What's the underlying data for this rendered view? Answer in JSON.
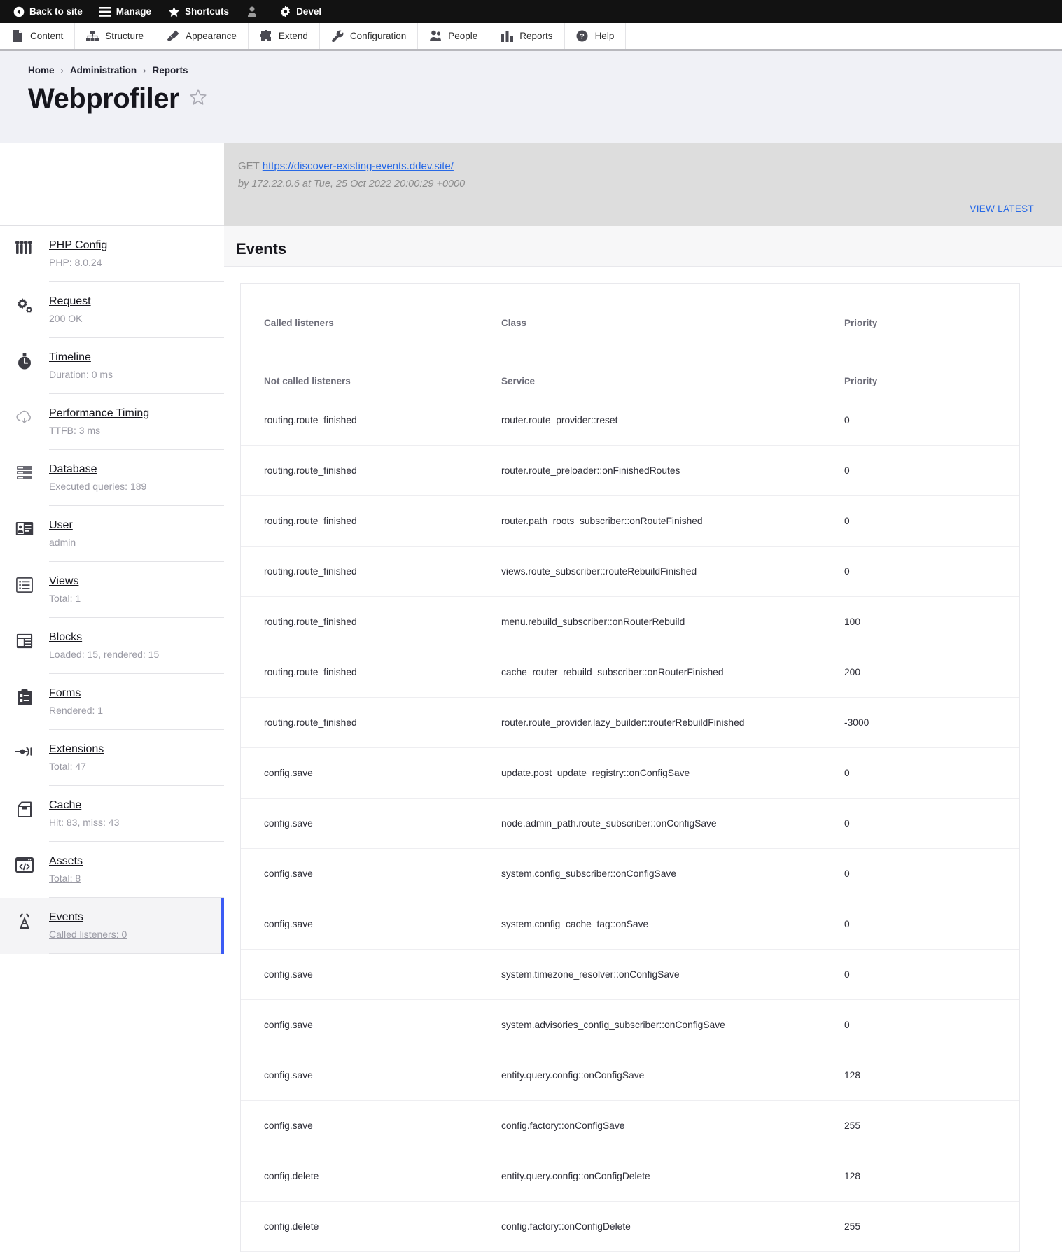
{
  "admin_bar": {
    "items": [
      {
        "label": "Back to site",
        "icon": "back-arrow-circle-icon"
      },
      {
        "label": "Manage",
        "icon": "hamburger-icon"
      },
      {
        "label": "Shortcuts",
        "icon": "star-icon"
      },
      {
        "label": "",
        "icon": "user-person-icon"
      },
      {
        "label": "Devel",
        "icon": "gear-icon"
      }
    ]
  },
  "menu_bar": {
    "items": [
      {
        "label": "Content",
        "icon": "page-icon"
      },
      {
        "label": "Structure",
        "icon": "sitemap-icon"
      },
      {
        "label": "Appearance",
        "icon": "paintbrush-icon"
      },
      {
        "label": "Extend",
        "icon": "puzzle-icon"
      },
      {
        "label": "Configuration",
        "icon": "wrench-icon"
      },
      {
        "label": "People",
        "icon": "people-icon"
      },
      {
        "label": "Reports",
        "icon": "bar-chart-icon"
      },
      {
        "label": "Help",
        "icon": "question-circle-icon"
      }
    ]
  },
  "breadcrumb": {
    "items": [
      "Home",
      "Administration",
      "Reports"
    ],
    "separator": "›"
  },
  "page": {
    "title": "Webprofiler",
    "star_label": "☆"
  },
  "request_banner": {
    "method": "GET",
    "url": "https://discover-existing-events.ddev.site/",
    "meta": "by 172.22.0.6 at Tue, 25 Oct 2022 20:00:29 +0000",
    "view_latest": "VIEW LATEST"
  },
  "sidebar": {
    "items": [
      {
        "title": "PHP Config",
        "sub": "PHP: 8.0.24",
        "icon": "sliders-icon",
        "active": false
      },
      {
        "title": "Request",
        "sub": "200 OK",
        "icon": "gears-icon",
        "active": false
      },
      {
        "title": "Timeline",
        "sub": "Duration: 0 ms",
        "icon": "stopwatch-icon",
        "active": false
      },
      {
        "title": "Performance Timing",
        "sub": "TTFB: 3 ms",
        "icon": "cloud-download-icon",
        "active": false
      },
      {
        "title": "Database",
        "sub": "Executed queries: 189",
        "icon": "database-icon",
        "active": false
      },
      {
        "title": "User",
        "sub": "admin",
        "icon": "id-card-icon",
        "active": false
      },
      {
        "title": "Views",
        "sub": "Total: 1",
        "icon": "list-icon",
        "active": false
      },
      {
        "title": "Blocks",
        "sub": "Loaded: 15, rendered: 15",
        "icon": "layout-blocks-icon",
        "active": false
      },
      {
        "title": "Forms",
        "sub": "Rendered: 1",
        "icon": "clipboard-form-icon",
        "active": false
      },
      {
        "title": "Extensions",
        "sub": "Total: 47",
        "icon": "plug-arrow-icon",
        "active": false
      },
      {
        "title": "Cache",
        "sub": "Hit: 83, miss: 43",
        "icon": "cache-box-icon",
        "active": false
      },
      {
        "title": "Assets",
        "sub": "Total: 8",
        "icon": "code-window-icon",
        "active": false
      },
      {
        "title": "Events",
        "sub": "Called listeners: 0",
        "icon": "broadcast-antenna-icon",
        "active": true
      }
    ]
  },
  "main": {
    "section_title": "Events",
    "called_headers": [
      "Called listeners",
      "Class",
      "Priority"
    ],
    "not_called_headers": [
      "Not called listeners",
      "Service",
      "Priority"
    ],
    "called_rows": [],
    "not_called_rows": [
      {
        "event": "routing.route_finished",
        "service": "router.route_provider::reset",
        "priority": "0"
      },
      {
        "event": "routing.route_finished",
        "service": "router.route_preloader::onFinishedRoutes",
        "priority": "0"
      },
      {
        "event": "routing.route_finished",
        "service": "router.path_roots_subscriber::onRouteFinished",
        "priority": "0"
      },
      {
        "event": "routing.route_finished",
        "service": "views.route_subscriber::routeRebuildFinished",
        "priority": "0"
      },
      {
        "event": "routing.route_finished",
        "service": "menu.rebuild_subscriber::onRouterRebuild",
        "priority": "100"
      },
      {
        "event": "routing.route_finished",
        "service": "cache_router_rebuild_subscriber::onRouterFinished",
        "priority": "200"
      },
      {
        "event": "routing.route_finished",
        "service": "router.route_provider.lazy_builder::routerRebuildFinished",
        "priority": "-3000"
      },
      {
        "event": "config.save",
        "service": "update.post_update_registry::onConfigSave",
        "priority": "0"
      },
      {
        "event": "config.save",
        "service": "node.admin_path.route_subscriber::onConfigSave",
        "priority": "0"
      },
      {
        "event": "config.save",
        "service": "system.config_subscriber::onConfigSave",
        "priority": "0"
      },
      {
        "event": "config.save",
        "service": "system.config_cache_tag::onSave",
        "priority": "0"
      },
      {
        "event": "config.save",
        "service": "system.timezone_resolver::onConfigSave",
        "priority": "0"
      },
      {
        "event": "config.save",
        "service": "system.advisories_config_subscriber::onConfigSave",
        "priority": "0"
      },
      {
        "event": "config.save",
        "service": "entity.query.config::onConfigSave",
        "priority": "128"
      },
      {
        "event": "config.save",
        "service": "config.factory::onConfigSave",
        "priority": "255"
      },
      {
        "event": "config.delete",
        "service": "entity.query.config::onConfigDelete",
        "priority": "128"
      },
      {
        "event": "config.delete",
        "service": "config.factory::onConfigDelete",
        "priority": "255"
      }
    ]
  },
  "colors": {
    "admin_bar_bg": "#121212",
    "page_header_bg": "#f0f1f6",
    "banner_bg": "#dddddd",
    "link": "#2769e6",
    "accent": "#3b5bf5",
    "muted": "#9a9aa4"
  }
}
